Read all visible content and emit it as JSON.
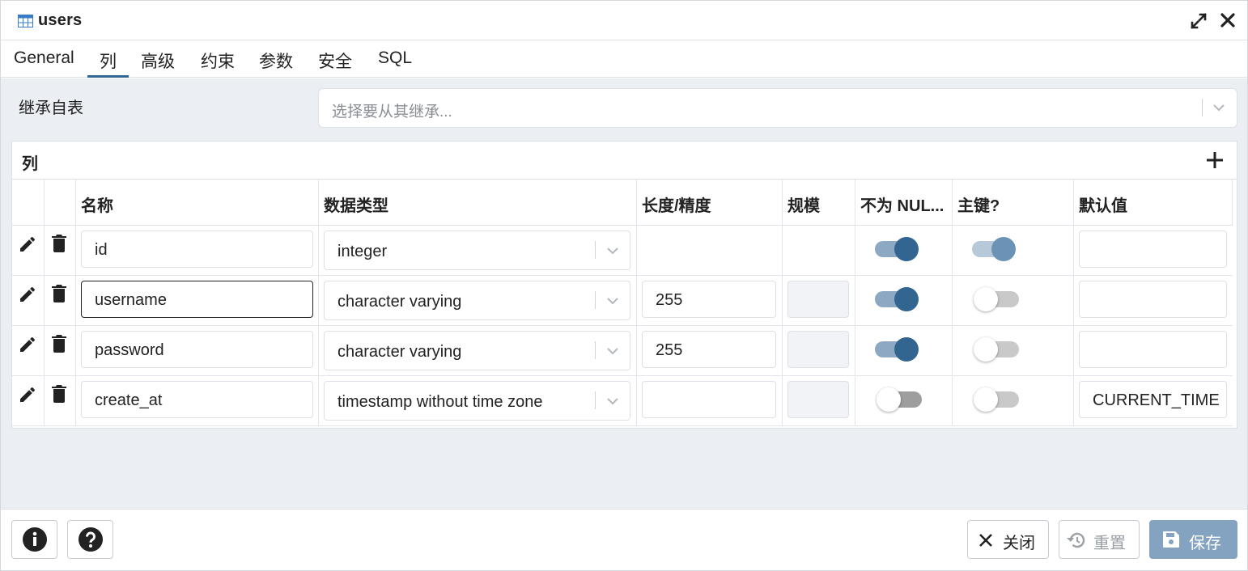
{
  "window": {
    "title": "users"
  },
  "tabs": [
    {
      "label": "General"
    },
    {
      "label": "列"
    },
    {
      "label": "高级"
    },
    {
      "label": "约束"
    },
    {
      "label": "参数"
    },
    {
      "label": "安全"
    },
    {
      "label": "SQL"
    }
  ],
  "active_tab": "列",
  "inherit": {
    "label": "继承自表",
    "placeholder": "选择要从其继承..."
  },
  "columns_panel": {
    "title": "列",
    "headers": {
      "name": "名称",
      "type": "数据类型",
      "length": "长度/精度",
      "scale": "规模",
      "not_null": "不为 NUL...",
      "pk": "主键?",
      "default": "默认值"
    },
    "rows": [
      {
        "name": "id",
        "type": "integer",
        "length": "",
        "scale": "",
        "not_null": true,
        "pk": true,
        "default": ""
      },
      {
        "name": "username",
        "type": "character varying",
        "length": "255",
        "scale": "",
        "not_null": true,
        "pk": false,
        "default": ""
      },
      {
        "name": "password",
        "type": "character varying",
        "length": "255",
        "scale": "",
        "not_null": true,
        "pk": false,
        "default": ""
      },
      {
        "name": "create_at",
        "type": "timestamp without time zone",
        "length": "",
        "scale": "",
        "not_null": false,
        "pk": false,
        "default": "CURRENT_TIME"
      }
    ]
  },
  "footer": {
    "close_label": "关闭",
    "reset_label": "重置",
    "save_label": "保存"
  },
  "colors": {
    "accent": "#326690",
    "save_bg": "#84a3c0",
    "body_bg": "#ebeef3"
  },
  "icons": [
    "table-icon",
    "maximize-icon",
    "close-icon",
    "add-icon",
    "edit-icon",
    "delete-icon",
    "chevron-down-icon",
    "info-icon",
    "help-icon",
    "reset-icon",
    "save-icon"
  ]
}
